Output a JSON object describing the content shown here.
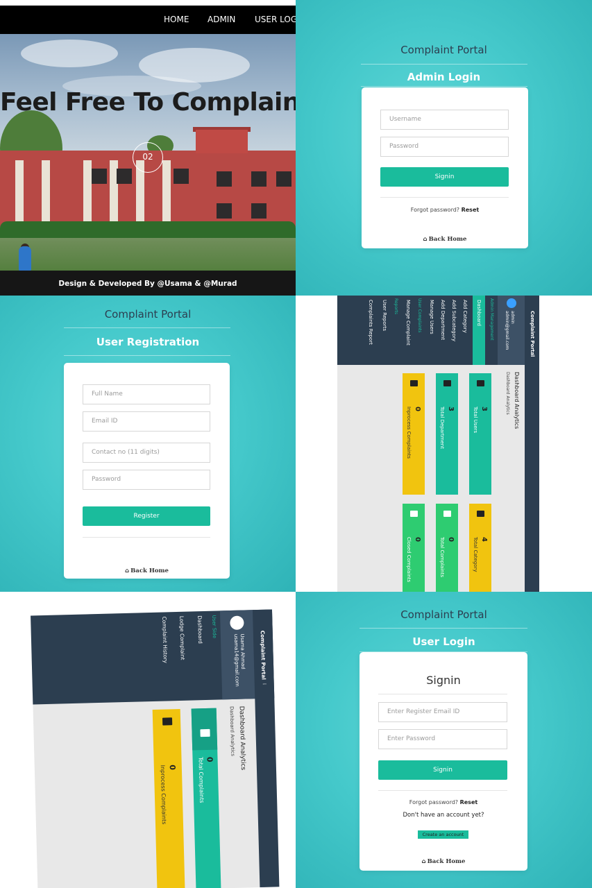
{
  "landing": {
    "nav": [
      "HOME",
      "ADMIN",
      "USER LOGI"
    ],
    "hero_title": "Feel Free To Complaint",
    "slide_indicator": "02",
    "footer": "Design & Developed By @Usama & @Murad"
  },
  "admin_login": {
    "portal_title": "Complaint Portal",
    "subtitle": "Admin Login",
    "username_placeholder": "Username",
    "password_placeholder": "Password",
    "signin": "Signin",
    "forgot": "Forgot password?",
    "reset": "Reset",
    "back_home": "Back Home"
  },
  "user_registration": {
    "portal_title": "Complaint Portal",
    "subtitle": "User Registration",
    "fields": [
      "Full Name",
      "Email ID",
      "Contact no (11 digits)",
      "Password"
    ],
    "register": "Register",
    "back_home": "Back Home"
  },
  "admin_dashboard": {
    "brand": "Complaint Portal",
    "user_name": "admin",
    "user_email": "admin@gmail.com",
    "section_admin": "Admin Management",
    "menu": [
      "Dashboard",
      "Add Category",
      "Add Subcategory",
      "Add Department",
      "Manage Users"
    ],
    "section_user": "User Complaints",
    "complaint_menu": [
      "Manage Complaint"
    ],
    "section_reports": "Reports",
    "report_menu": [
      "User Reports",
      "Complaints Report"
    ],
    "heading": "Dashboard Analytics",
    "breadcrumb": "Dashboard Analytics",
    "stats": [
      {
        "label": "Total Users",
        "value": "3",
        "color": "#1abc9c"
      },
      {
        "label": "Total Department",
        "value": "3",
        "color": "#1abc9c"
      },
      {
        "label": "Inprocess Complaints",
        "value": "0",
        "color": "#f1c40f"
      },
      {
        "label": "Total Category",
        "value": "4",
        "color": "#f1c40f"
      },
      {
        "label": "Total Complaints",
        "value": "0",
        "color": "#2ecc71"
      },
      {
        "label": "Closed Complaints",
        "value": "0",
        "color": "#2ecc71"
      }
    ]
  },
  "user_dashboard": {
    "brand": "Complaint Portal",
    "user_name": "Usama Ahmad",
    "user_email": "usama14@gmail.com",
    "section": "User Side",
    "menu": [
      "Dashboard",
      "Lodge Complaint",
      "Complaint History"
    ],
    "heading": "Dashboard Analytics",
    "breadcrumb": "Dashboard Analytics",
    "stats": [
      {
        "label": "Total Complaints",
        "value": "0",
        "color": "#1abc9c"
      },
      {
        "label": "Inprocess Complaints",
        "value": "0",
        "color": "#f1c40f"
      }
    ]
  },
  "user_login": {
    "portal_title": "Complaint Portal",
    "subtitle": "User Login",
    "heading": "Signin",
    "email_placeholder": "Enter Register Email ID",
    "password_placeholder": "Enter Password",
    "signin": "Signin",
    "forgot": "Forgot password?",
    "reset": "Reset",
    "no_account": "Don't have an account yet?",
    "create_account": "Create an account",
    "back_home": "Back Home"
  }
}
